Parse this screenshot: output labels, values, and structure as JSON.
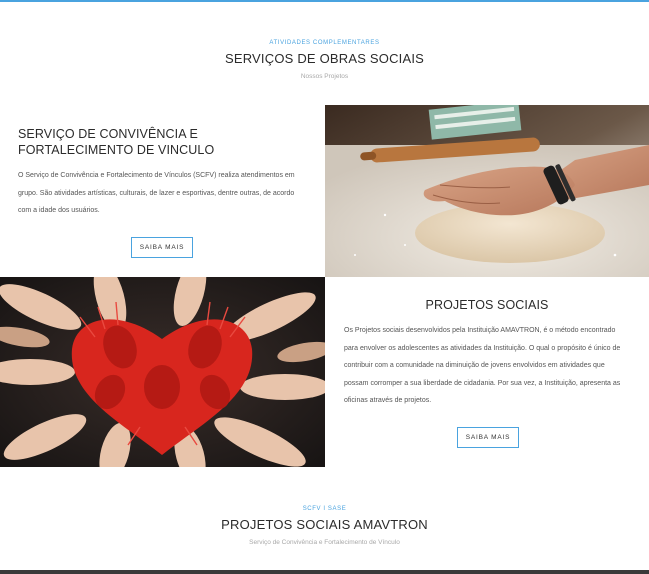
{
  "header_top": {
    "eyebrow": "ATIVIDADES COMPLEMENTARES",
    "title": "SERVIÇOS DE OBRAS SOCIAIS",
    "subtitle": "Nossos Projetos"
  },
  "scfv_card": {
    "title": "SERVIÇO DE CONVIVÊNCIA E FORTALECIMENTO DE VINCULO",
    "text": "O Serviço de Convivência e Fortalecimento de Vínculos (SCFV) realiza atendimentos em grupo. São atividades artísticas, culturais, de lazer e esportivas, dentre outras, de acordo com a idade dos usuários.",
    "button_label": "SAIBA MAIS"
  },
  "projetos_card": {
    "title": "PROJETOS SOCIAIS",
    "text": "Os Projetos sociais desenvolvidos pela Instituição AMAVTRON, é o método encontrado para envolver os adolescentes as atividades da Instituição. O qual o propósito é único de contribuir com a comunidade na diminuição de jovens envolvidos em atividades que possam corromper a sua liberdade de cidadania. Por sua vez, a Instituição, apresenta as oficinas através de projetos.",
    "button_label": "SAIBA MAIS"
  },
  "header_bottom": {
    "eyebrow": "SCFV I SASE",
    "title": "PROJETOS SOCIAIS AMAVTRON",
    "subtitle": "Serviço de Convivência e Fortalecimento de Vínculo"
  },
  "colors": {
    "accent": "#4aa3df",
    "heart_red": "#d8261e"
  },
  "images": {
    "dough": "hands-kneading-dough-photo",
    "hands": "hands-with-red-painted-heart-photo"
  }
}
